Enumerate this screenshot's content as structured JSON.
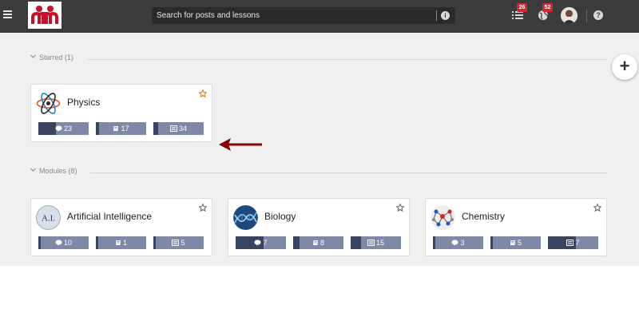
{
  "header": {
    "search_placeholder": "Search for posts and lessons",
    "notifications": [
      {
        "icon": "list-icon",
        "count": "26"
      },
      {
        "icon": "globe-icon",
        "count": "52"
      }
    ],
    "help_label": "?",
    "add_label": "+"
  },
  "colors": {
    "topbar": "#3b3b3b",
    "badge": "#d9262c",
    "stat_light": "#7d89a6",
    "stat_dark": "#394560",
    "arrow": "#8b0000",
    "star_active": "#e07b00"
  },
  "sections": {
    "starred": {
      "label": "Starred (1)",
      "cards": [
        {
          "title": "Physics",
          "starred": true,
          "icon": "atom-icon",
          "stats": [
            {
              "icon": "comment-icon",
              "value": "23",
              "fill": 0.35
            },
            {
              "icon": "book-icon",
              "value": "17",
              "fill": 0.06
            },
            {
              "icon": "list-icon",
              "value": "34",
              "fill": 0.1
            }
          ]
        }
      ]
    },
    "modules": {
      "label": "Modules (8)",
      "cards": [
        {
          "title": "Artificial Intelligence",
          "starred": false,
          "icon": "ai-icon",
          "icon_text": "A.I.",
          "stats": [
            {
              "icon": "comment-icon",
              "value": "10",
              "fill": 0
            },
            {
              "icon": "book-icon",
              "value": "1",
              "fill": 0
            },
            {
              "icon": "list-icon",
              "value": "5",
              "fill": 0
            }
          ]
        },
        {
          "title": "Biology",
          "starred": false,
          "icon": "dna-icon",
          "stats": [
            {
              "icon": "comment-icon",
              "value": "7",
              "fill": 0.55
            },
            {
              "icon": "book-icon",
              "value": "8",
              "fill": 0.12
            },
            {
              "icon": "list-icon",
              "value": "15",
              "fill": 0.2
            }
          ]
        },
        {
          "title": "Chemistry",
          "starred": false,
          "icon": "molecule-icon",
          "stats": [
            {
              "icon": "comment-icon",
              "value": "3",
              "fill": 0
            },
            {
              "icon": "book-icon",
              "value": "5",
              "fill": 0
            },
            {
              "icon": "list-icon",
              "value": "7",
              "fill": 0.55
            }
          ]
        }
      ]
    }
  }
}
